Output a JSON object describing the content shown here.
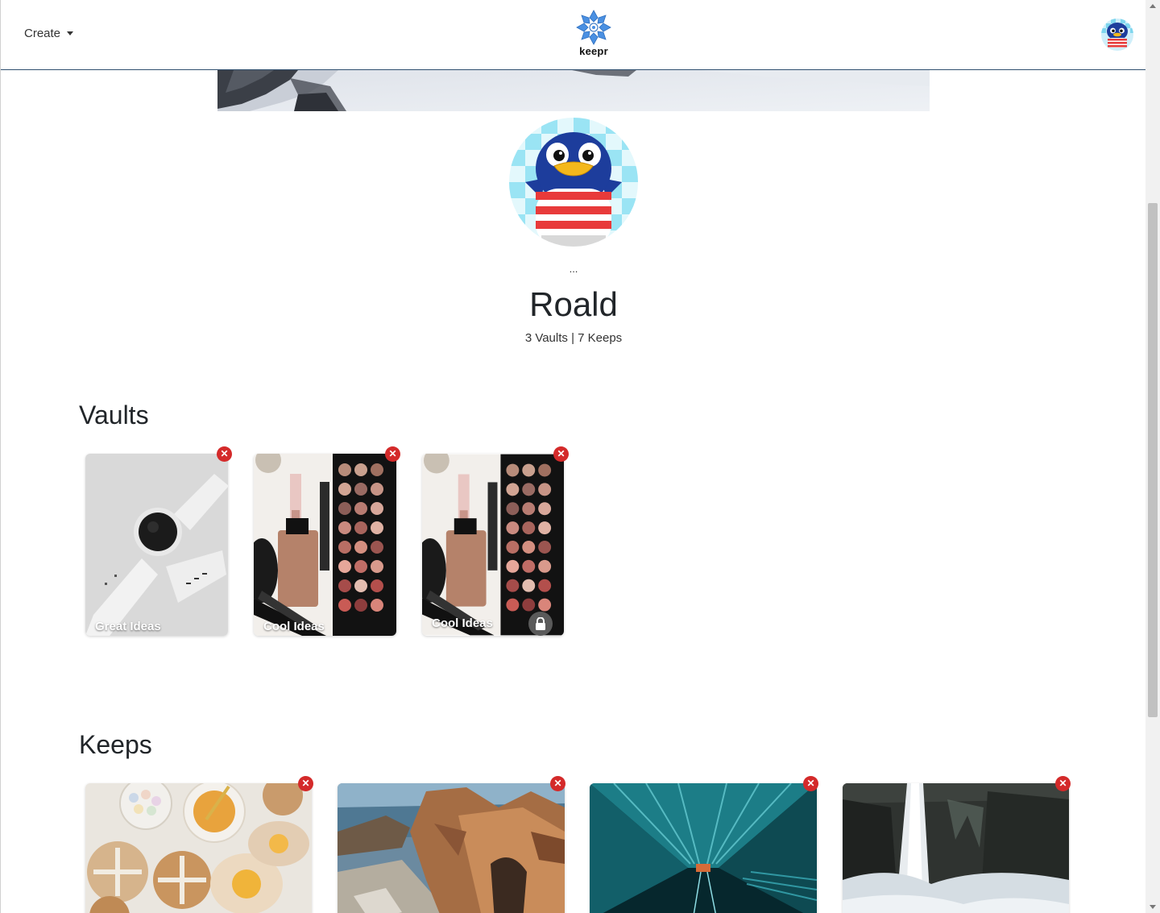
{
  "nav": {
    "create_label": "Create",
    "logo_text": "keepr",
    "logo_icon": "snowflake-logo-icon",
    "user_avatar": "penguin-avatar"
  },
  "profile": {
    "menu_dots": "...",
    "name": "Roald",
    "counts": "3 Vaults | 7 Keeps"
  },
  "vaults": {
    "title": "Vaults",
    "items": [
      {
        "label": "Great Ideas",
        "image": "smartwatch-photo",
        "private": false
      },
      {
        "label": "Cool Ideas",
        "image": "makeup-palette-photo",
        "private": false
      },
      {
        "label": "Cool Ideas",
        "image": "makeup-palette-photo",
        "private": true
      }
    ]
  },
  "keeps": {
    "title": "Keeps",
    "items": [
      {
        "image": "hot-cross-buns-photo"
      },
      {
        "image": "coastal-rock-arch-photo"
      },
      {
        "image": "teal-tunnel-photo"
      },
      {
        "image": "waterfall-photo"
      }
    ]
  },
  "colors": {
    "accent_blue": "#4a90e2",
    "delete_red": "#d42a2a",
    "navbar_border": "#2f4f6f"
  },
  "icons": {
    "delete": "close-icon",
    "lock": "lock-icon",
    "dropdown": "caret-down-icon"
  }
}
